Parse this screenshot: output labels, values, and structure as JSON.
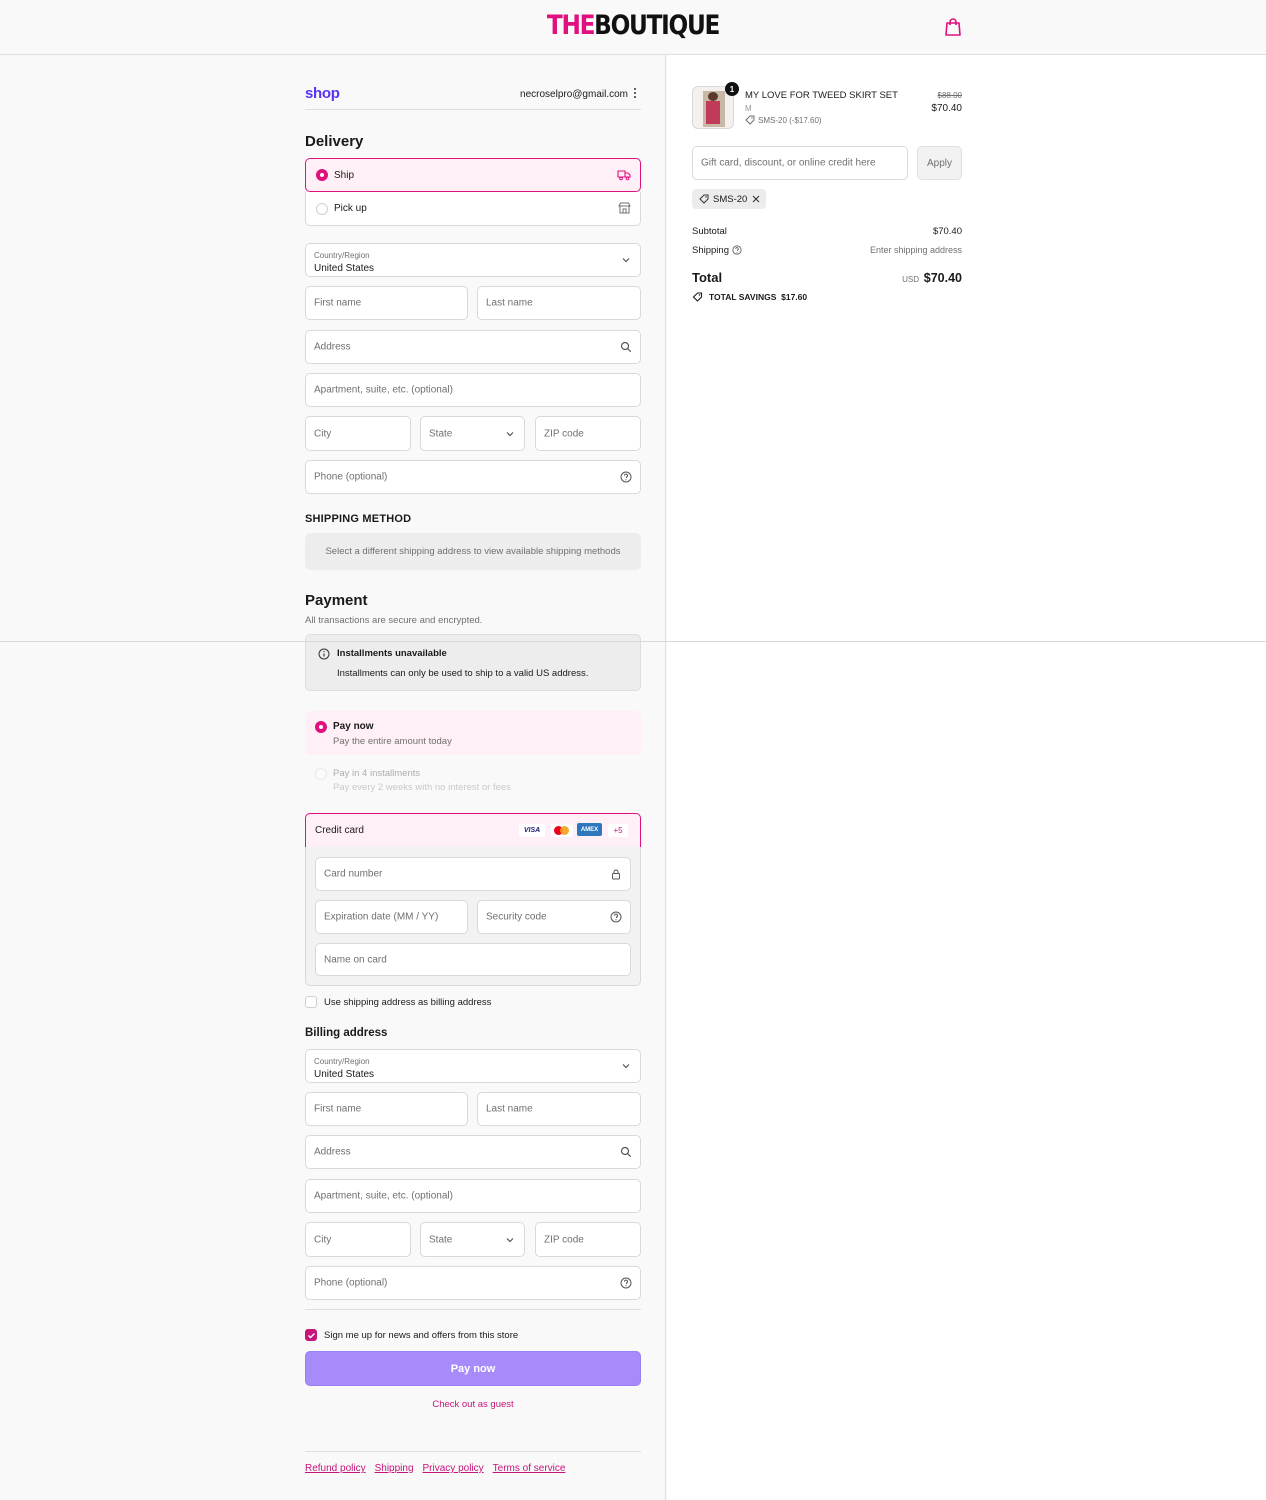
{
  "header": {
    "logo_part1": "THE",
    "logo_part2": "BOUTIQUE"
  },
  "account": {
    "shop_label": "shop",
    "email": "necroselpro@gmail.com"
  },
  "delivery": {
    "heading": "Delivery",
    "options": [
      {
        "label": "Ship",
        "selected": true,
        "icon": "truck-icon"
      },
      {
        "label": "Pick up",
        "selected": false,
        "icon": "store-icon"
      }
    ],
    "country_label": "Country/Region",
    "country_value": "United States",
    "first_name": "First name",
    "last_name": "Last name",
    "address": "Address",
    "apartment": "Apartment, suite, etc. (optional)",
    "city": "City",
    "state": "State",
    "zip": "ZIP code",
    "phone": "Phone (optional)"
  },
  "shipping_method": {
    "heading": "SHIPPING METHOD",
    "notice": "Select a different shipping address to view available shipping methods"
  },
  "payment": {
    "heading": "Payment",
    "subheading": "All transactions are secure and encrypted.",
    "installments_title": "Installments unavailable",
    "installments_text": "Installments can only be used to ship to a valid US address.",
    "pay_now_label": "Pay now",
    "pay_now_sub": "Pay the entire amount today",
    "pay_installments_label": "Pay in 4 installments",
    "pay_installments_sub": "Pay every 2 weeks with no interest or fees",
    "credit_card_label": "Credit card",
    "brands": [
      "VISA",
      "Mastercard",
      "AMEX",
      "+5"
    ],
    "card_number": "Card number",
    "expiration": "Expiration date (MM / YY)",
    "security_code": "Security code",
    "name_on_card": "Name on card",
    "use_shipping_as_billing": "Use shipping address as billing address"
  },
  "billing": {
    "heading": "Billing address",
    "country_label": "Country/Region",
    "country_value": "United States",
    "first_name": "First name",
    "last_name": "Last name",
    "address": "Address",
    "apartment": "Apartment, suite, etc. (optional)",
    "city": "City",
    "state": "State",
    "zip": "ZIP code",
    "phone": "Phone (optional)"
  },
  "newsletter": {
    "label": "Sign me up for news and offers from this store",
    "checked": true
  },
  "actions": {
    "pay_now": "Pay now",
    "guest": "Check out as guest"
  },
  "footer": {
    "links": [
      "Refund policy",
      "Shipping",
      "Privacy policy",
      "Terms of service"
    ]
  },
  "summary": {
    "item_name": "MY LOVE FOR TWEED SKIRT SET",
    "item_variant": "M",
    "item_discount": "SMS-20 (-$17.60)",
    "item_quantity": "1",
    "item_original_price": "$88.00",
    "item_price": "$70.40",
    "discount_placeholder": "Gift card, discount, or online credit here",
    "apply_label": "Apply",
    "applied_code": "SMS-20",
    "subtotal_label": "Subtotal",
    "subtotal_value": "$70.40",
    "shipping_label": "Shipping",
    "shipping_value": "Enter shipping address",
    "total_label": "Total",
    "currency": "USD",
    "total_value": "$70.40",
    "savings_label": "TOTAL SAVINGS",
    "savings_value": "$17.60"
  },
  "colors": {
    "brand_pink": "#e0107e",
    "shop_purple": "#5a31f4",
    "pay_button": "#a78bfa"
  }
}
